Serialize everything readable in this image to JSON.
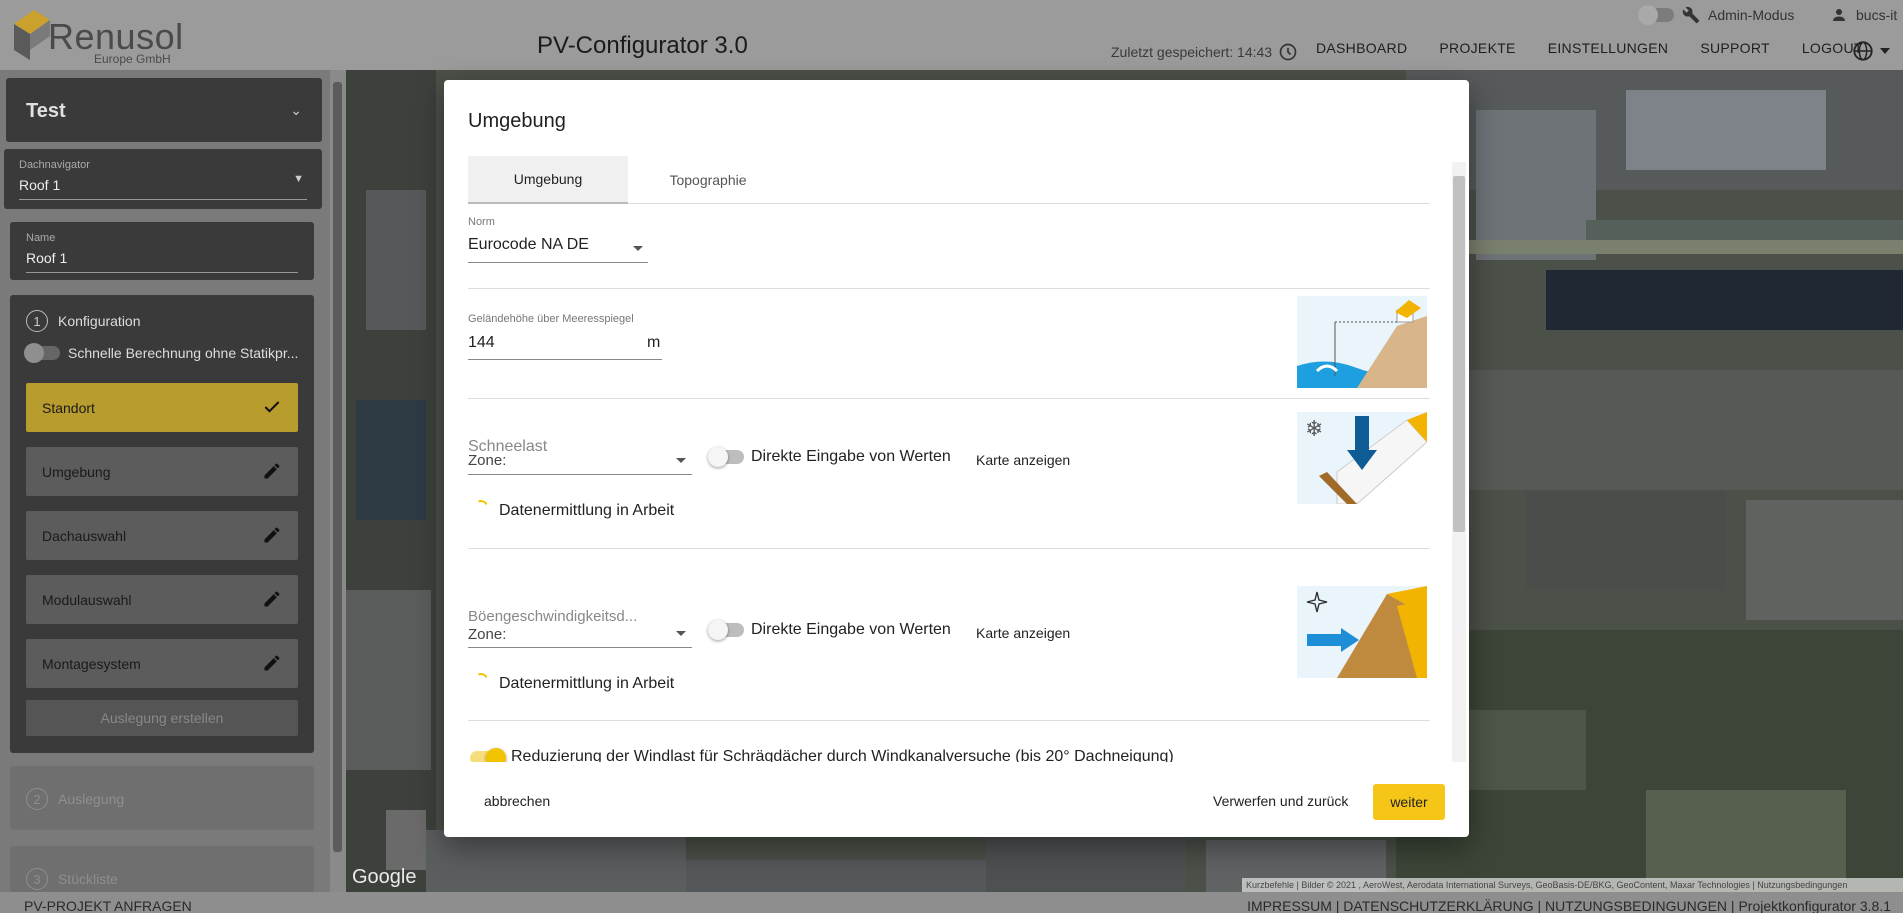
{
  "header": {
    "logo_text": "Renusol",
    "logo_sub": "Europe GmbH",
    "app_title": "PV-Configurator 3.0",
    "admin_label": "Admin-Modus",
    "user_label": "bucs-it",
    "saved_label": "Zuletzt gespeichert: 14:43",
    "nav": [
      "DASHBOARD",
      "PROJEKTE",
      "EINSTELLUNGEN",
      "SUPPORT",
      "LOGOUT"
    ]
  },
  "sidebar": {
    "project_name": "Test",
    "roof_nav_label": "Dachnavigator",
    "roof_nav_value": "Roof 1",
    "name_label": "Name",
    "name_value": "Roof 1",
    "step1": {
      "num": "1",
      "label": "Konfiguration"
    },
    "quick_calc_label": "Schnelle Berechnung ohne Statikpr...",
    "items": [
      {
        "label": "Standort",
        "icon": "check-icon",
        "active": true
      },
      {
        "label": "Umgebung",
        "icon": "pencil-icon"
      },
      {
        "label": "Dachauswahl",
        "icon": "pencil-icon"
      },
      {
        "label": "Modulauswahl",
        "icon": "pencil-icon"
      },
      {
        "label": "Montagesystem",
        "icon": "pencil-icon"
      }
    ],
    "create_button": "Auslegung erstellen",
    "step2": {
      "num": "2",
      "label": "Auslegung"
    },
    "step3": {
      "num": "3",
      "label": "Stückliste"
    }
  },
  "map": {
    "google_label": "Google",
    "attribution": "Kurzbefehle | Bilder © 2021 , AeroWest, Aerodata International Surveys, GeoBasis-DE/BKG, GeoContent, Maxar Technologies | Nutzungsbedingungen"
  },
  "footer": {
    "left": "PV-PROJEKT ANFRAGEN",
    "right": "IMPRESSUM | DATENSCHUTZERKLÄRUNG | NUTZUNGSBEDINGUNGEN | Projektkonfigurator 3.8.1"
  },
  "modal": {
    "title": "Umgebung",
    "tabs": [
      "Umgebung",
      "Topographie"
    ],
    "norm_label": "Norm",
    "norm_value": "Eurocode NA DE",
    "elevation_label": "Geländehöhe über Meeresspiegel",
    "elevation_value": "144",
    "elevation_unit": "m",
    "snow_label": "Schneelast",
    "snow_zone": "Zone:",
    "direct_input_label": "Direkte Eingabe von Werten",
    "map_button": "Karte anzeigen",
    "loading_label": "Datenermittlung in Arbeit",
    "gust_label": "Böengeschwindigkeitsd...",
    "gust_zone": "Zone:",
    "wind_reduction_label": "Reduzierung der Windlast für Schrägdächer durch Windkanalversuche (bis 20° Dachneigung)",
    "wind_reduction_on": true,
    "cancel_button": "abbrechen",
    "discard_button": "Verwerfen und zurück",
    "next_button": "weiter"
  },
  "colors": {
    "accent": "#f5c518",
    "sidebar_dark": "#3a3a3a",
    "header_grey": "#9b9b9b"
  }
}
